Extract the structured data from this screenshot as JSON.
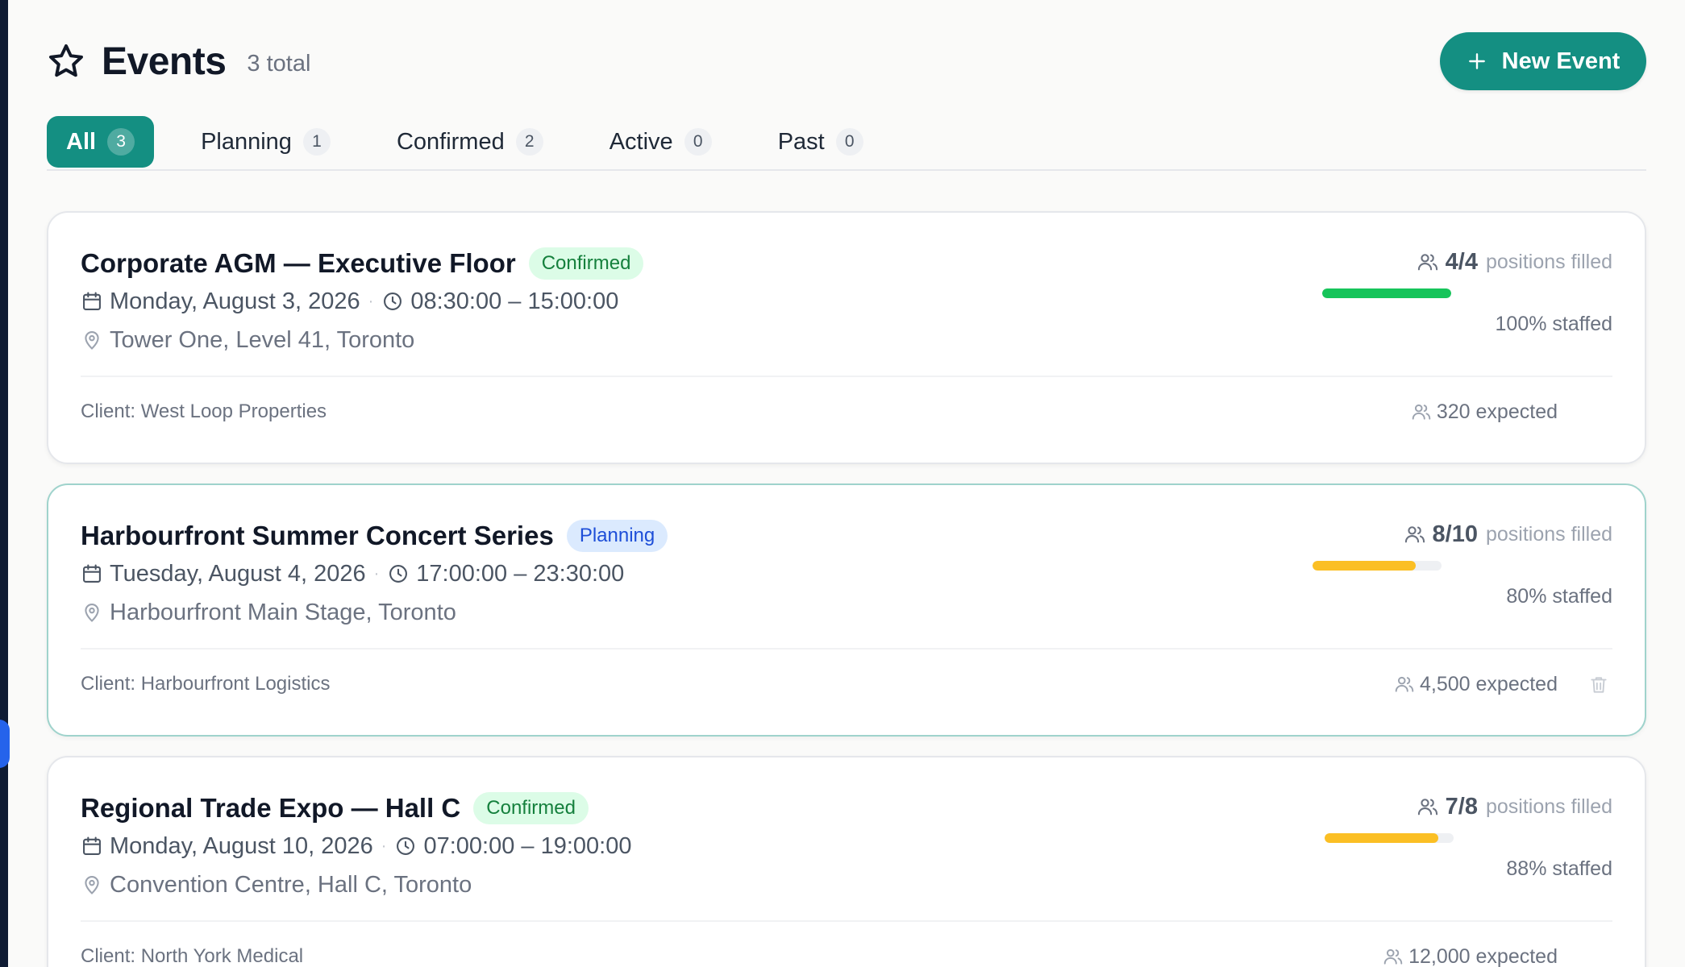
{
  "header": {
    "title": "Events",
    "total": "3 total",
    "new_event_label": "New Event"
  },
  "tabs": [
    {
      "label": "All",
      "count": "3",
      "active": true
    },
    {
      "label": "Planning",
      "count": "1"
    },
    {
      "label": "Confirmed",
      "count": "2"
    },
    {
      "label": "Active",
      "count": "0"
    },
    {
      "label": "Past",
      "count": "0"
    }
  ],
  "events": [
    {
      "name": "Corporate AGM — Executive Floor",
      "status": "Confirmed",
      "date": "Monday, August 3, 2026",
      "time": "08:30:00 – 15:00:00",
      "location": "Tower One, Level 41, Toronto",
      "client": "Client: West Loop Properties",
      "expected": "320 expected",
      "ratio": "4/4",
      "filled_label": "positions filled",
      "staffed": "100% staffed",
      "fraction": 1.0,
      "bar_color": "#16c45a"
    },
    {
      "name": "Harbourfront Summer Concert Series",
      "status": "Planning",
      "date": "Tuesday, August 4, 2026",
      "time": "17:00:00 – 23:30:00",
      "location": "Harbourfront Main Stage, Toronto",
      "client": "Client: Harbourfront Logistics",
      "expected": "4,500 expected",
      "ratio": "8/10",
      "filled_label": "positions filled",
      "staffed": "80% staffed",
      "fraction": 0.8,
      "bar_color": "#fbbf24"
    },
    {
      "name": "Regional Trade Expo — Hall C",
      "status": "Confirmed",
      "date": "Monday, August 10, 2026",
      "time": "07:00:00 – 19:00:00",
      "location": "Convention Centre, Hall C, Toronto",
      "client": "Client: North York Medical",
      "expected": "12,000 expected",
      "ratio": "7/8",
      "filled_label": "positions filled",
      "staffed": "88% staffed",
      "fraction": 0.88,
      "bar_color": "#fbbf24"
    }
  ]
}
